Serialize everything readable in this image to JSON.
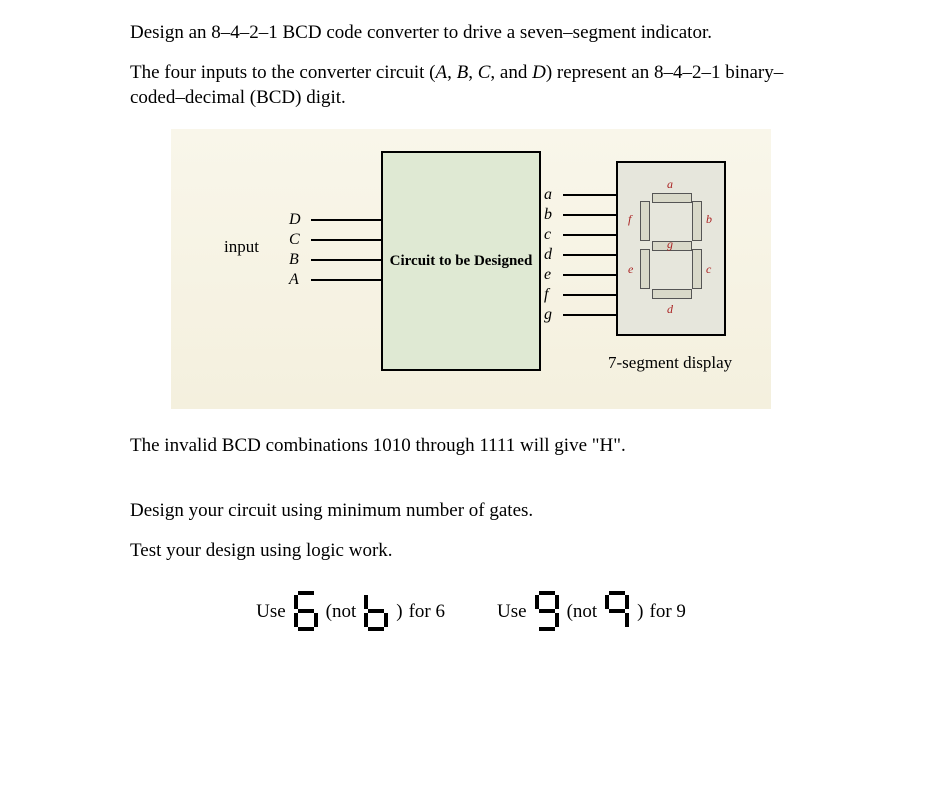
{
  "title": "Design an 8–4–2–1 BCD code converter to drive a seven–segment indicator.",
  "intro": {
    "line1_a": "The four inputs to the converter circuit (",
    "A": "A",
    "sep1": ", ",
    "B": "B",
    "sep2": ", ",
    "C": "C",
    "sep3": ", and ",
    "D": "D",
    "line1_b": ") represent an 8–4–2–1 binary–coded–decimal (BCD) digit."
  },
  "diagram": {
    "input_word": "input",
    "inputs": [
      "D",
      "C",
      "B",
      "A"
    ],
    "converter_label": "Circuit to be Designed",
    "outputs": [
      "a",
      "b",
      "c",
      "d",
      "e",
      "f",
      "g"
    ],
    "display_caption": "7-segment display",
    "seg_labels": {
      "a": "a",
      "b": "b",
      "c": "c",
      "d": "d",
      "e": "e",
      "f": "f",
      "g": "g"
    }
  },
  "invalid_text": "The invalid BCD combinations 1010 through 1111 will give \"H\".",
  "min_gates": "Design your circuit using minimum number of gates.",
  "test_text": "Test your design using logic work.",
  "use_row": {
    "use": "Use",
    "not_open": "(not",
    "not_close": ")",
    "for6": "for 6",
    "for9": "for 9"
  }
}
